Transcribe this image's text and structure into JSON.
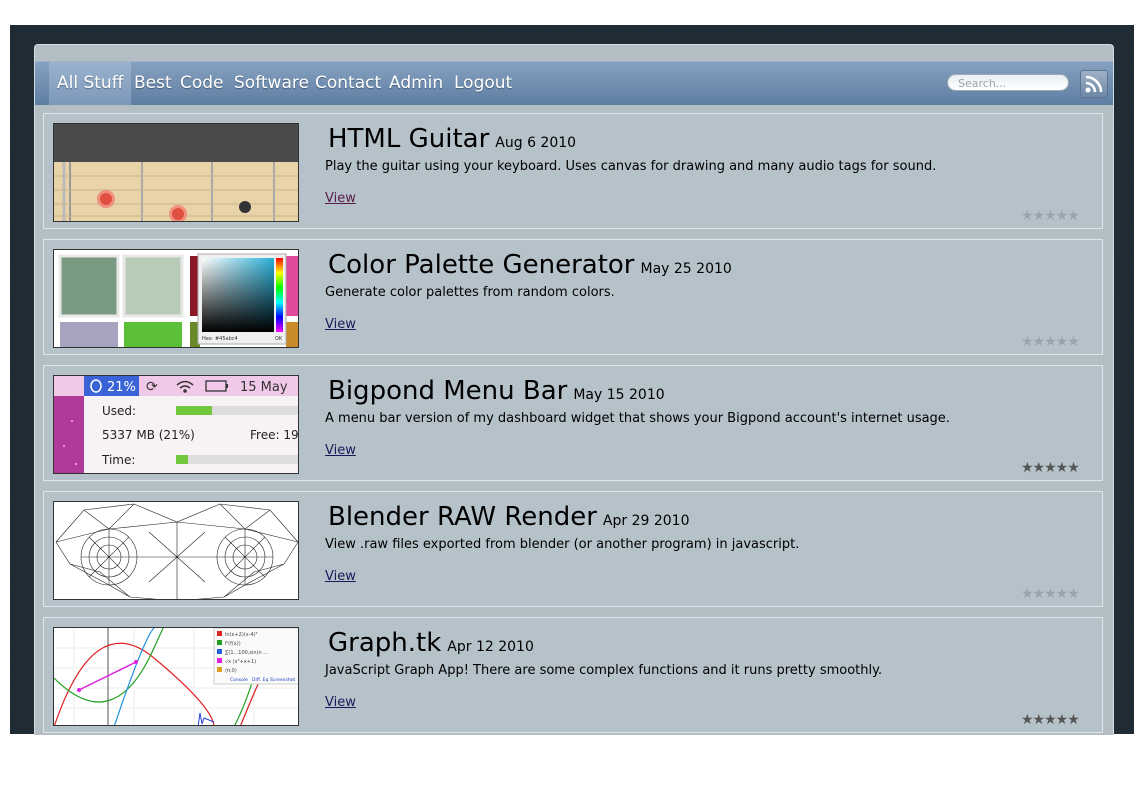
{
  "nav": {
    "items": [
      "All Stuff",
      "Best",
      "Code",
      "Software",
      "Contact",
      "Admin",
      "Logout"
    ],
    "search_placeholder": "Search..."
  },
  "projects": [
    {
      "title": "HTML Guitar",
      "date": "Aug 6 2010",
      "description": "Play the guitar using your keyboard. Uses canvas for drawing and many audio tags for sound.",
      "link": "View",
      "rating": "★★★★★",
      "rated": false
    },
    {
      "title": "Color Palette Generator",
      "date": "May 25 2010",
      "description": "Generate color palettes from random colors.",
      "link": "View",
      "rating": "★★★★★",
      "rated": false
    },
    {
      "title": "Bigpond Menu Bar",
      "date": "May 15 2010",
      "description": "A menu bar version of my dashboard widget that shows your Bigpond account's internet usage.",
      "link": "View",
      "rating": "★★★★★",
      "rated": true
    },
    {
      "title": "Blender RAW Render",
      "date": "Apr 29 2010",
      "description": "View .raw files exported from blender (or another program) in javascript.",
      "link": "View",
      "rating": "★★★★★",
      "rated": false
    },
    {
      "title": "Graph.tk",
      "date": "Apr 12 2010",
      "description": "JavaScript Graph App! There are some complex functions and it runs pretty smoothly.",
      "link": "View",
      "rating": "★★★★★",
      "rated": true
    }
  ],
  "thumbs": {
    "palette_hex": "Hex: #45abc4",
    "palette_ok": "OK",
    "bigpond": {
      "percent": "21%",
      "date": "15 May",
      "used_label": "Used:",
      "usage": "5337 MB (21%)",
      "free": "Free: 19",
      "time_label": "Time:"
    },
    "graph_legend": [
      "ln(x+2)(x-4)²",
      "f'(f(x))",
      "∑(1...100,sin(n ...",
      "√x  (x⁵+x+1)",
      "(π,0)"
    ],
    "graph_tabs": [
      "Console",
      "Diff. Eq",
      "Screenshot"
    ]
  }
}
